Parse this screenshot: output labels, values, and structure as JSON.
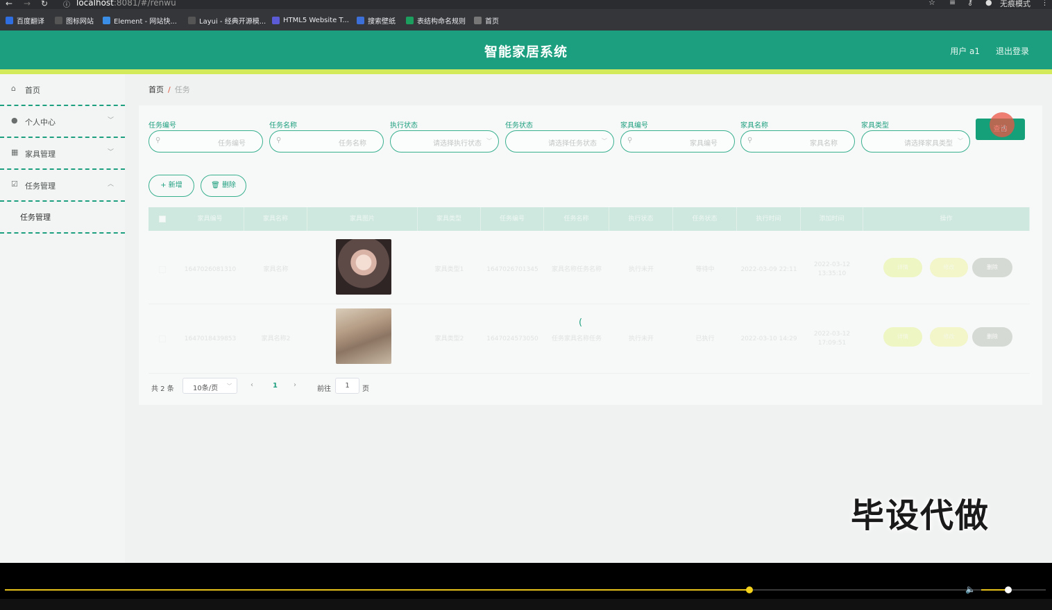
{
  "browser": {
    "url_host": "localhost",
    "url_path": ":8081/#/renwu",
    "incognito_label": "无痕模式",
    "bookmarks": [
      {
        "label": "百度翻译",
        "color": "#2f6ee0"
      },
      {
        "label": "图标网站",
        "color": "#555555"
      },
      {
        "label": "Element - 网站快...",
        "color": "#3a8ee6"
      },
      {
        "label": "Layui - 经典开源模...",
        "color": "#555555"
      },
      {
        "label": "HTML5 Website T...",
        "color": "#5b5bd6"
      },
      {
        "label": "搜索壁纸",
        "color": "#3d6fd9"
      },
      {
        "label": "表结构命名规则",
        "color": "#1c9f5e"
      },
      {
        "label": "首页",
        "color": "#777777"
      }
    ]
  },
  "header": {
    "title": "智能家居系统",
    "user": "用户 a1",
    "logout": "退出登录",
    "brand_color": "#1c9f7e",
    "accent_color": "#d3ea5b"
  },
  "sidebar": {
    "items": [
      {
        "label": "首页",
        "icon": "home-icon"
      },
      {
        "label": "个人中心",
        "icon": "user-icon"
      },
      {
        "label": "家具管理",
        "icon": "grid-icon"
      },
      {
        "label": "任务管理",
        "icon": "checkbox-icon"
      }
    ],
    "submenu": {
      "label": "任务管理"
    }
  },
  "breadcrumb": {
    "home": "首页",
    "sep": "/",
    "current": "任务"
  },
  "filters": [
    {
      "label": "任务编号",
      "placeholder": "任务编号",
      "type": "input"
    },
    {
      "label": "任务名称",
      "placeholder": "任务名称",
      "type": "input"
    },
    {
      "label": "执行状态",
      "placeholder": "请选择执行状态",
      "type": "select"
    },
    {
      "label": "任务状态",
      "placeholder": "请选择任务状态",
      "type": "select"
    },
    {
      "label": "家具编号",
      "placeholder": "家具编号",
      "type": "input"
    },
    {
      "label": "家具名称",
      "placeholder": "家具名称",
      "type": "input"
    },
    {
      "label": "家具类型",
      "placeholder": "请选择家具类型",
      "type": "select"
    }
  ],
  "search_button": "查询",
  "actions": {
    "add": "+ 新增",
    "delete": "删除"
  },
  "table": {
    "columns": [
      "家具编号",
      "家具名称",
      "家具图片",
      "家具类型",
      "任务编号",
      "任务名称",
      "执行状态",
      "任务状态",
      "执行时间",
      "添加时间",
      "操作"
    ],
    "rows": [
      {
        "furniture_no": "1647026081310",
        "furniture_name": "家具名称",
        "furniture_type": "家具类型1",
        "task_no": "1647026701345",
        "task_name": "家具名称任务名称",
        "exec_status": "执行未开",
        "task_status": "等待中",
        "exec_time": "2022-03-09 22:11",
        "add_time": "2022-03-12 13:35:10"
      },
      {
        "furniture_no": "1647018439853",
        "furniture_name": "家具名称2",
        "furniture_type": "家具类型2",
        "task_no": "1647024573050",
        "task_name": "任务家具名称任务",
        "exec_status": "执行未开",
        "task_status": "已执行",
        "exec_time": "2022-03-10 14:29",
        "add_time": "2022-03-12 17:09:51"
      }
    ],
    "ops": {
      "detail": "详情",
      "edit": "修改",
      "delete": "删除"
    }
  },
  "pager": {
    "total": "共 2 条",
    "size": "10条/页",
    "page": "1",
    "goto": "前往",
    "goto_value": "1",
    "unit": "页"
  },
  "watermark": "毕设代做",
  "player": {
    "progress": 0.715,
    "volume": 0.44
  }
}
